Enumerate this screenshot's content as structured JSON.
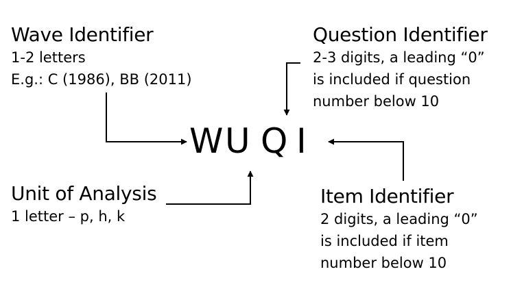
{
  "code": {
    "letters": [
      "W",
      "U",
      "Q",
      "I"
    ]
  },
  "wave": {
    "title": "Wave Identifier",
    "lines": [
      "1-2 letters",
      "E.g.: C (1986), BB (2011)"
    ]
  },
  "question": {
    "title": "Question Identifier",
    "lines": [
      "2-3 digits, a leading “0”",
      "is included if question",
      "number below 10"
    ]
  },
  "unit": {
    "title": "Unit of Analysis",
    "lines": [
      "1 letter – p, h, k"
    ]
  },
  "item": {
    "title": "Item Identifier",
    "lines": [
      "2 digits, a leading “0”",
      "is included if item",
      "number below 10"
    ]
  }
}
